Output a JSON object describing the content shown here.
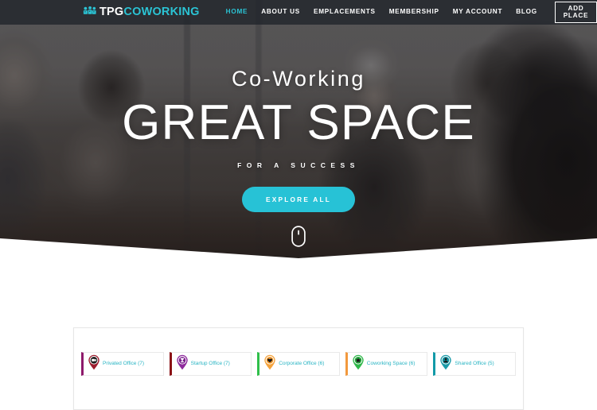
{
  "header": {
    "logo": {
      "icon": "people-group-icon",
      "text_primary": "TPG",
      "text_secondary": "COWORKING",
      "color_primary": "#ffffff",
      "color_secondary": "#2bc3d4"
    },
    "nav_items": [
      {
        "label": "HOME",
        "active": true
      },
      {
        "label": "ABOUT US",
        "active": false
      },
      {
        "label": "EMPLACEMENTS",
        "active": false
      },
      {
        "label": "MEMBERSHIP",
        "active": false
      },
      {
        "label": "MY ACCOUNT",
        "active": false
      },
      {
        "label": "BLOG",
        "active": false
      }
    ],
    "add_place_label": "ADD PLACE",
    "background_color": "#20242a",
    "accent_color": "#2bc3d4"
  },
  "hero": {
    "subtitle": "Co-Working",
    "title": "GREAT SPACE",
    "tagline": "FOR A SUCCESS",
    "cta_label": "EXPLORE ALL",
    "cta_color": "#27c2d6",
    "scroll_icon": "mouse-scroll-icon"
  },
  "categories": [
    {
      "label": "Privated Office (7)",
      "count": 7,
      "accent": "#8e1a6b",
      "pin_color": "#9c1d2e",
      "glyph": "video-camera-icon"
    },
    {
      "label": "Startup Office (7)",
      "count": 7,
      "accent": "#8b1216",
      "pin_color": "#8e2a9c",
      "glyph": "trophy-icon"
    },
    {
      "label": "Corporate Office (6)",
      "count": 6,
      "accent": "#2fbf4a",
      "pin_color": "#f5a33c",
      "glyph": "heart-icon"
    },
    {
      "label": "Coworking Space (6)",
      "count": 6,
      "accent": "#f2993d",
      "pin_color": "#2fb84a",
      "glyph": "star-icon"
    },
    {
      "label": "Shared Office (5)",
      "count": 5,
      "accent": "#129aa8",
      "pin_color": "#1a9aa8",
      "glyph": "person-icon"
    }
  ]
}
